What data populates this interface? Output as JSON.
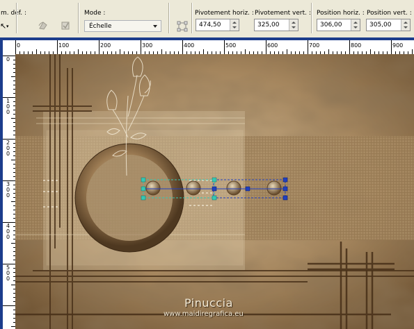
{
  "toolbar": {
    "preset_label": "m. déf. :",
    "mode_label": "Mode :",
    "mode_value": "Échelle",
    "pivot_h_label": "Pivotement horiz. :",
    "pivot_h_value": "474,50",
    "pivot_v_label": "Pivotement vert. :",
    "pivot_v_value": "325,00",
    "pos_h_label": "Position horiz. :",
    "pos_h_value": "306,00",
    "pos_v_label": "Position vert. :",
    "pos_v_value": "305,00"
  },
  "ruler": {
    "h_labels": [
      "0",
      "100",
      "200",
      "300",
      "400",
      "500",
      "600",
      "700",
      "800",
      "900"
    ],
    "v_labels": [
      "0",
      "1\n0\n0",
      "2\n0\n0",
      "3\n0\n0",
      "4\n0\n0",
      "5\n0\n0"
    ]
  },
  "canvas": {
    "watermark_title": "Pinuccia",
    "watermark_url": "www.maidiregrafica.eu"
  },
  "colors": {
    "frame": "#1c3d8c",
    "sepia_dark": "#5a4128",
    "sepia_light": "#cdb896",
    "handle_teal": "#34c8b4",
    "handle_blue": "#2040c0"
  }
}
